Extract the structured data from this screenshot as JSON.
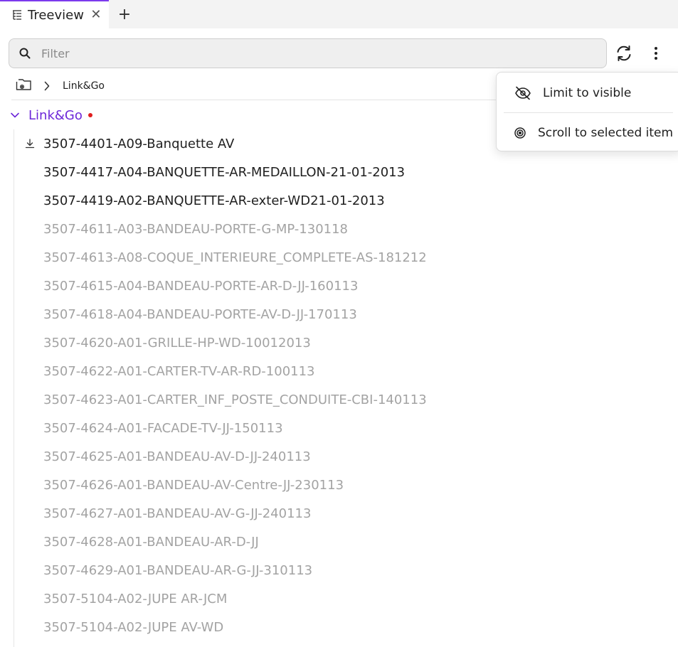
{
  "tab": {
    "label": "Treeview",
    "close": "✕",
    "add": "+"
  },
  "filter": {
    "placeholder": "Filter",
    "value": ""
  },
  "breadcrumb": {
    "text": "Link&Go"
  },
  "tree": {
    "root": {
      "label": "Link&Go"
    },
    "items": [
      {
        "label": "3507-4401-A09-Banquette AV",
        "state": "loaded",
        "downloaded": true
      },
      {
        "label": "3507-4417-A04-BANQUETTE-AR-MEDAILLON-21-01-2013",
        "state": "loaded",
        "downloaded": false
      },
      {
        "label": "3507-4419-A02-BANQUETTE-AR-exter-WD21-01-2013",
        "state": "loaded",
        "downloaded": false
      },
      {
        "label": "3507-4611-A03-BANDEAU-PORTE-G-MP-130118",
        "state": "dim",
        "downloaded": false
      },
      {
        "label": "3507-4613-A08-COQUE_INTERIEURE_COMPLETE-AS-181212",
        "state": "dim",
        "downloaded": false
      },
      {
        "label": "3507-4615-A04-BANDEAU-PORTE-AR-D-JJ-160113",
        "state": "dim",
        "downloaded": false
      },
      {
        "label": "3507-4618-A04-BANDEAU-PORTE-AV-D-JJ-170113",
        "state": "dim",
        "downloaded": false
      },
      {
        "label": "3507-4620-A01-GRILLE-HP-WD-10012013",
        "state": "dim",
        "downloaded": false
      },
      {
        "label": "3507-4622-A01-CARTER-TV-AR-RD-100113",
        "state": "dim",
        "downloaded": false
      },
      {
        "label": "3507-4623-A01-CARTER_INF_POSTE_CONDUITE-CBI-140113",
        "state": "dim",
        "downloaded": false
      },
      {
        "label": "3507-4624-A01-FACADE-TV-JJ-150113",
        "state": "dim",
        "downloaded": false
      },
      {
        "label": "3507-4625-A01-BANDEAU-AV-D-JJ-240113",
        "state": "dim",
        "downloaded": false
      },
      {
        "label": "3507-4626-A01-BANDEAU-AV-Centre-JJ-230113",
        "state": "dim",
        "downloaded": false
      },
      {
        "label": "3507-4627-A01-BANDEAU-AV-G-JJ-240113",
        "state": "dim",
        "downloaded": false
      },
      {
        "label": "3507-4628-A01-BANDEAU-AR-D-JJ",
        "state": "dim",
        "downloaded": false
      },
      {
        "label": "3507-4629-A01-BANDEAU-AR-G-JJ-310113",
        "state": "dim",
        "downloaded": false
      },
      {
        "label": "3507-5104-A02-JUPE AR-JCM",
        "state": "dim",
        "downloaded": false
      },
      {
        "label": "3507-5104-A02-JUPE AV-WD",
        "state": "dim",
        "downloaded": false
      }
    ]
  },
  "menu": {
    "items": [
      {
        "label": "Limit to visible",
        "icon": "eye-off-icon"
      },
      {
        "label": "Scroll to selected item",
        "icon": "target-icon"
      }
    ]
  },
  "colors": {
    "accent": "#6d28d9",
    "tab_indicator": "#7c3aed",
    "dot": "#e01e1e",
    "dim_text": "#a3a3a3"
  }
}
